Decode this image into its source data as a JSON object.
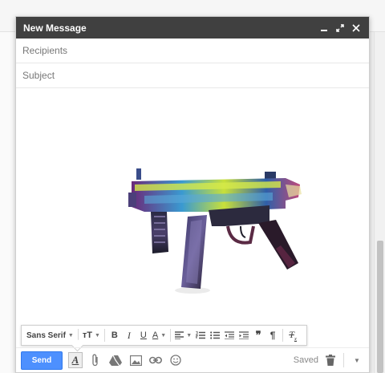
{
  "window": {
    "title": "New Message"
  },
  "fields": {
    "recipients_placeholder": "Recipients",
    "subject_placeholder": "Subject"
  },
  "format_toolbar": {
    "font_family": "Sans Serif",
    "icons": [
      "font-size-icon",
      "bold-icon",
      "italic-icon",
      "underline-icon",
      "text-color-icon",
      "align-icon",
      "numbered-list-icon",
      "bulleted-list-icon",
      "indent-less-icon",
      "indent-more-icon",
      "quote-icon",
      "paragraph-icon",
      "remove-formatting-icon"
    ]
  },
  "bottom_bar": {
    "send_label": "Send",
    "status": "Saved"
  },
  "colors": {
    "titlebar": "#404040",
    "send": "#4d90fe"
  }
}
